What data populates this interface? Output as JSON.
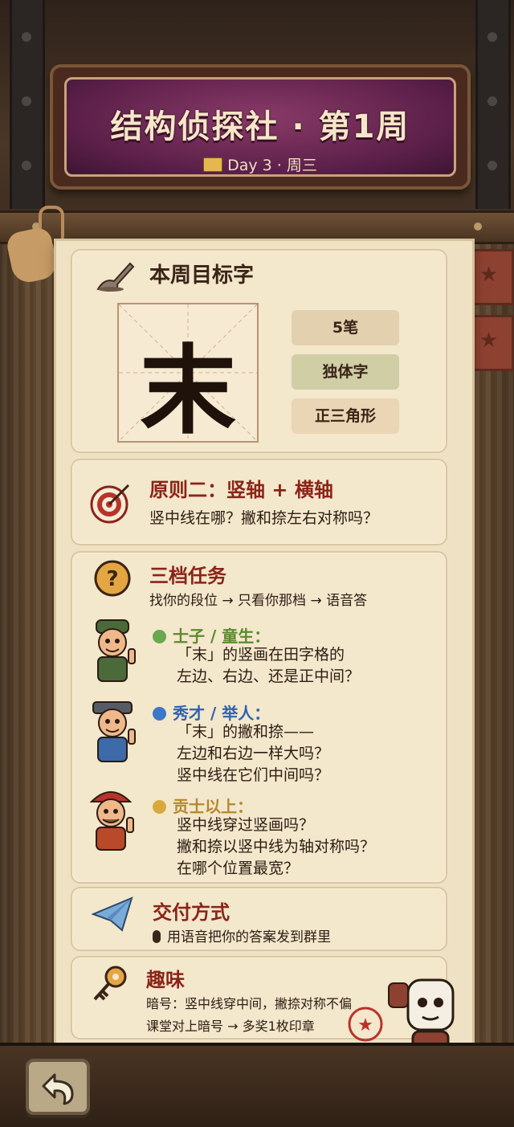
{
  "header": {
    "title": "结构侦探社 · 第1周",
    "subtitle": "Day 3 · 周三"
  },
  "target": {
    "heading": "本周目标字",
    "character": "末",
    "tags": [
      "5笔",
      "独体字",
      "正三角形"
    ]
  },
  "principle": {
    "heading": "原则二：竖轴 + 横轴",
    "text": "竖中线在哪？撇和捺左右对称吗？"
  },
  "tasks": {
    "heading": "三档任务",
    "intro": "找你的段位 → 只看你那档 → 语音答",
    "tiers": [
      {
        "label": "士子 / 童生：",
        "color": "#6aa84f",
        "lines": [
          "「末」的竖画在田字格的",
          "左边、右边、还是正中间？"
        ]
      },
      {
        "label": "秀才 / 举人：",
        "color": "#3d78c8",
        "lines": [
          "「末」的撇和捺——",
          "左边和右边一样大吗？",
          "竖中线在它们中间吗？"
        ]
      },
      {
        "label": "贡士以上：",
        "color": "#d8a93c",
        "lines": [
          "竖中线穿过竖画吗？",
          "撇和捺以竖中线为轴对称吗？",
          "在哪个位置最宽？"
        ]
      }
    ]
  },
  "delivery": {
    "heading": "交付方式",
    "text": "用语音把你的答案发到群里"
  },
  "fun": {
    "heading": "趣味",
    "line1": "暗号：竖中线穿中间，撇捺对称不偏",
    "line2": "课堂对上暗号 → 多奖1枚印章"
  },
  "icons": [
    "book-icon",
    "brush-icon",
    "target-icon",
    "question-icon",
    "paper-plane-icon",
    "key-icon",
    "microphone-icon",
    "star-stamp-icon",
    "back-arrow-icon"
  ],
  "colors": {
    "title_bg": "#5a1f48",
    "heading_red": "#8a2418",
    "paper": "#efe1c3"
  }
}
